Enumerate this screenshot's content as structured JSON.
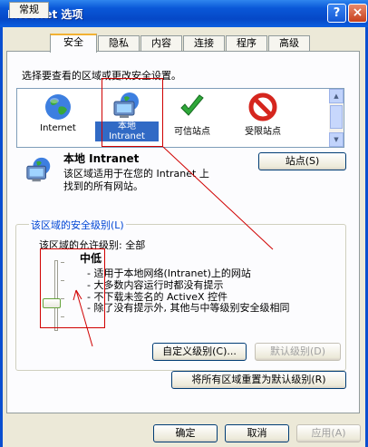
{
  "window": {
    "title": "Internet 选项",
    "help_glyph": "?",
    "close_glyph": "×"
  },
  "tabs": [
    "常规",
    "安全",
    "隐私",
    "内容",
    "连接",
    "程序",
    "高级"
  ],
  "active_tab": "安全",
  "security": {
    "zone_prompt": "选择要查看的区域或更改安全设置。",
    "zones": [
      "Internet",
      "本地\nIntranet",
      "可信站点",
      "受限站点"
    ],
    "selected_zone": "本地 Intranet",
    "selected_zone_desc": "该区域适用于在您的 Intranet 上\n找到的所有网站。",
    "sites_button": "站点(S)",
    "level_group_title": "该区域的安全级别(L)",
    "allowed_levels": "该区域的允许级别: 全部",
    "level_name": "中低",
    "level_bullets": [
      "- 适用于本地网络(Intranet)上的网站",
      "- 大多数内容运行时都没有提示",
      "- 不下载未签名的 ActiveX 控件",
      "- 除了没有提示外, 其他与中等级别安全级相同"
    ],
    "custom_level_button": "自定义级别(C)...",
    "default_level_button": "默认级别(D)",
    "reset_all_button": "将所有区域重置为默认级别(R)"
  },
  "footer": {
    "ok": "确定",
    "cancel": "取消",
    "apply": "应用(A)"
  },
  "colors": {
    "title_bar": "#0548c7",
    "selection": "#316ac5",
    "annotation": "#d00000",
    "group_title": "#0046d5"
  }
}
